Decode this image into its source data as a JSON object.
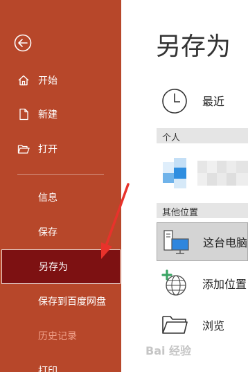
{
  "sidebar": {
    "items": [
      {
        "label": "开始",
        "icon": "home-icon"
      },
      {
        "label": "新建",
        "icon": "new-doc-icon"
      },
      {
        "label": "打开",
        "icon": "open-folder-icon"
      }
    ],
    "sub_items": [
      {
        "label": "信息"
      },
      {
        "label": "保存"
      },
      {
        "label": "另存为",
        "selected": true
      },
      {
        "label": "保存到百度网盘"
      },
      {
        "label": "历史记录",
        "disabled": true
      },
      {
        "label": "打印"
      }
    ]
  },
  "main": {
    "title": "另存为",
    "recent": {
      "label": "最近",
      "icon": "clock-icon"
    },
    "section_personal": "个人",
    "section_other": "其他位置",
    "locations": [
      {
        "label": "这台电脑",
        "icon": "computer-icon",
        "selected": true
      },
      {
        "label": "添加位置",
        "icon": "globe-add-icon"
      },
      {
        "label": "浏览",
        "icon": "folder-icon"
      }
    ]
  },
  "watermark": "Bai 经验",
  "colors": {
    "sidebar_bg": "#b7472a",
    "selected_bg": "#7d1112",
    "annotation_arrow": "#e8322b"
  }
}
